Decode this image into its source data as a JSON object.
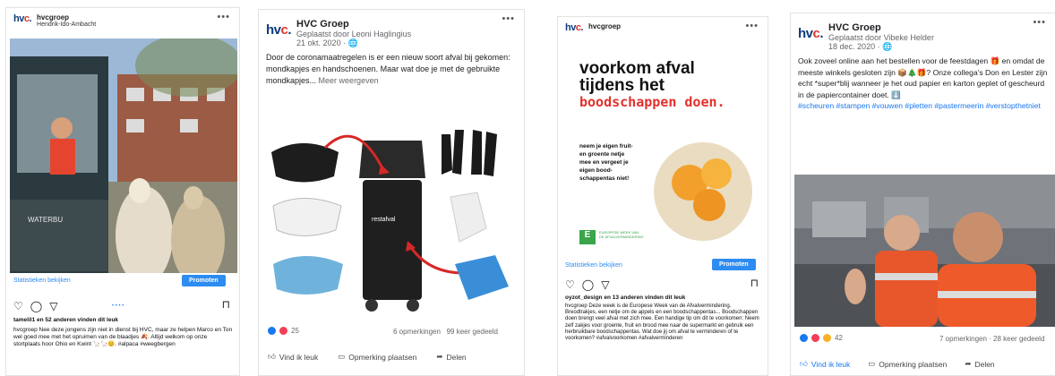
{
  "post1": {
    "account": "hvcgroep",
    "location": "Hendrik-Ido-Ambacht",
    "logo": "hvc",
    "insights_link": "Statistieken bekijken",
    "promote_button": "Promoten",
    "likes_text": "tamelil1 en 52 anderen vinden dit leuk",
    "caption": "hvcgroep Nee deze jongens zijn niet in dienst bij HVC, maar ze helpen Marco en Ton wel goed mee met het opruimen van de blaadjes 🍂. Altijd welkom op onze stortplaats hoor Ohio en Kwint 🦙🦙😊. #alpaca #weegbergen",
    "icons": [
      "heart-icon",
      "comment-icon",
      "share-icon",
      "bookmark-icon"
    ]
  },
  "post2": {
    "account": "HVC Groep",
    "posted_by": "Geplaatst door Leoni Haglingius",
    "date": "21 okt. 2020 · 🌐",
    "text": "Door de coronamaatregelen is er een nieuw soort afval bij gekomen: mondkapjes en handschoenen. Maar wat doe je met de gebruikte mondkapjes...",
    "more": "Meer weergeven",
    "bin_label": "restafval",
    "reactions_count": "25",
    "comments": "6 opmerkingen",
    "shares": "99 keer gedeeld",
    "actions": [
      "Vind ik leuk",
      "Opmerking plaatsen",
      "Delen"
    ]
  },
  "post3": {
    "account": "hvcgroep",
    "headline_1": "voorkom afval",
    "headline_2": "tijdens het",
    "headline_3": "boodschappen doen.",
    "tip": "neem je eigen fruit- en groente netje mee en vergeet je eigen bood- schappentas niet!",
    "badge": "EUROPESE WEEK VAN DE AFVALVERMINDERING",
    "insights_link": "Statistieken bekijken",
    "promote_button": "Promoten",
    "likes_text": "oyzot_design en 13 anderen vinden dit leuk",
    "caption": "hvcgroep Deze week is de Europese Week van de Afvalvermindering. Breodtrakjes, een netje om de appels en een boodschappentas... Boodschappen doen brengt veel afval met zich mee. Een handige tip om dit te voorkomen: Neem zelf zakjes voor groente, fruit en brood mee naar de supermarkt en gebruik een herbruikbare boodschappentas. Wat doe jij om afval te verminderen of te voorkomen? #afvalvoorkomen #afvalverminderen"
  },
  "post4": {
    "account": "HVC Groep",
    "posted_by": "Geplaatst door Vibeke Helder",
    "date": "18 dec. 2020 · 🌐",
    "text": "Ook zoveel online aan het bestellen voor de feestdagen 🎁 en omdat de meeste winkels gesloten zijn 📦🎄🎁? Onze collega's Don en Lester zijn echt *super*blij wanneer je het oud papier en karton geplet of gescheurd in de papiercontainer doet. ⬇️",
    "hashtags": "#scheuren #stampen #vouwen #pletten #pastermeerin #verstopthetniet",
    "reactions_count": "42",
    "counts": "7 opmerkingen · 28 keer gedeeld",
    "actions": [
      "Vind ik leuk",
      "Opmerking plaatsen",
      "Delen"
    ]
  }
}
